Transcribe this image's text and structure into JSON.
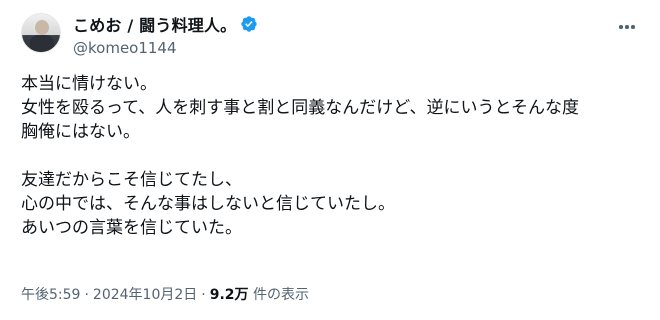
{
  "author": {
    "display_name": "こめお / 闘う料理人。",
    "handle": "@komeo1144",
    "verified": true,
    "avatar_icon": "avatar-person",
    "verified_color": "#1d9bf0"
  },
  "menu": {
    "icon": "more-horizontal-icon"
  },
  "tweet": {
    "lines_block1": [
      "本当に情けない。",
      "女性を殴るって、人を刺す事と割と同義なんだけど、逆にいうとそんな度",
      "胸俺にはない。"
    ],
    "lines_block2": [
      "友達だからこそ信じてたし、",
      "心の中では、そんな事はしないと信じていたし。",
      "あいつの言葉を信じていた。"
    ]
  },
  "meta": {
    "time": "午後5:59",
    "separator": "·",
    "date": "2024年10月2日",
    "views_count": "9.2万",
    "views_label": "件の表示"
  },
  "colors": {
    "text_primary": "#0f1419",
    "text_secondary": "#536471",
    "accent": "#1d9bf0"
  }
}
